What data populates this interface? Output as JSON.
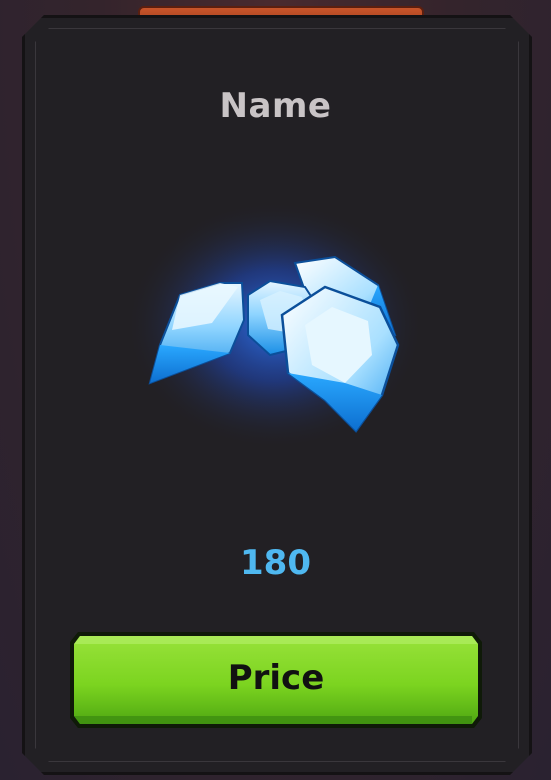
{
  "item": {
    "name": "Name",
    "amount": "180",
    "icon": "blue-gems-icon"
  },
  "buy_button": {
    "label": "Price"
  },
  "colors": {
    "card_bg": "#222024",
    "amount_text": "#4fb8f0",
    "button_green": "#7cd420",
    "title_text": "#c9c4c6"
  }
}
